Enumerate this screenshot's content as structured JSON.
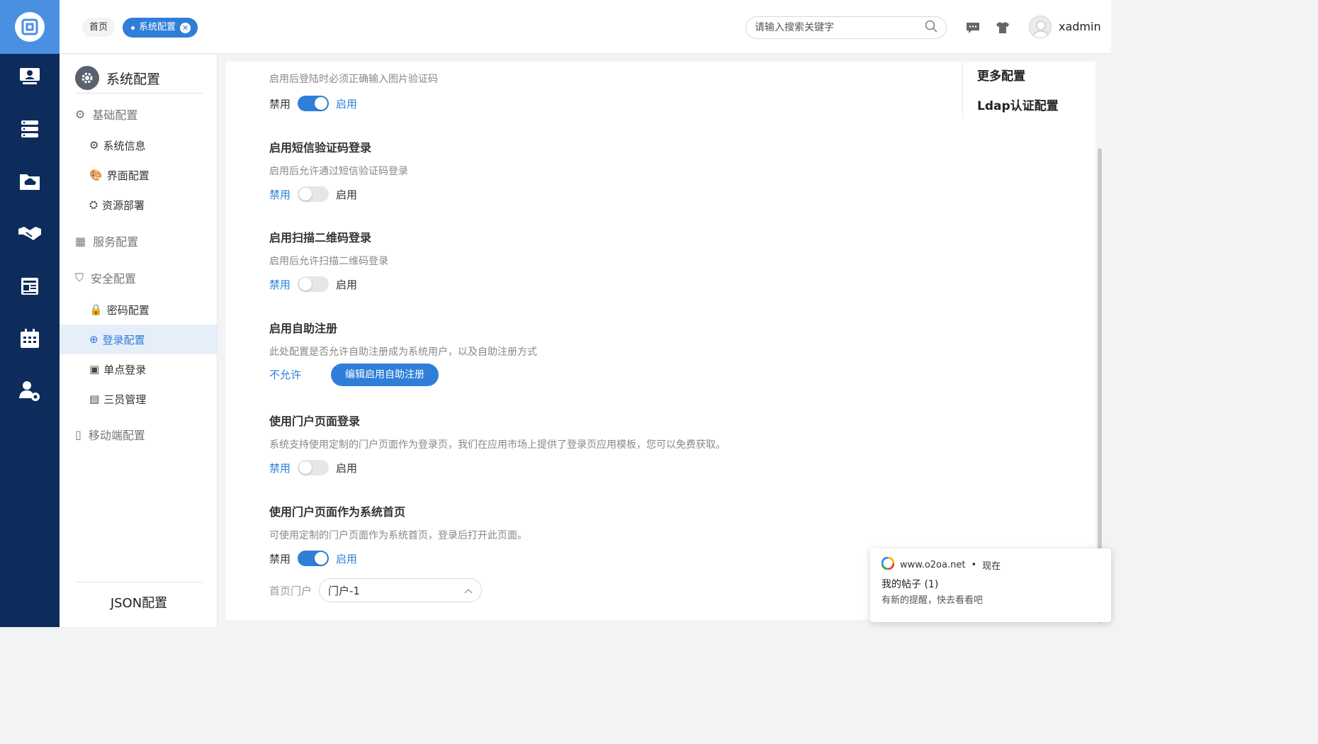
{
  "header": {
    "tabs": [
      {
        "label": "首页"
      },
      {
        "label": "系统配置"
      }
    ],
    "search_placeholder": "请输入搜索关键字",
    "username": "xadmin"
  },
  "rail_icons": [
    "logo-icon",
    "user-desk-icon",
    "server-icon",
    "cloud-folder-icon",
    "handshake-icon",
    "news-icon",
    "calendar-icon",
    "user-settings-icon"
  ],
  "subnav": {
    "title": "系统配置",
    "groups": {
      "basic": "基础配置",
      "service": "服务配置",
      "security": "安全配置",
      "mobile": "移动端配置"
    },
    "items": {
      "system_info": "系统信息",
      "ui_config": "界面配置",
      "resource_deploy": "资源部署",
      "password_config": "密码配置",
      "login_config": "登录配置",
      "sso": "单点登录",
      "three_admin": "三员管理"
    },
    "json_config": "JSON配置"
  },
  "main": {
    "captcha": {
      "desc": "启用后登陆时必须正确输入图片验证码",
      "off": "禁用",
      "on": "启用",
      "enabled": true
    },
    "sms": {
      "title": "启用短信验证码登录",
      "desc": "启用后允许通过短信验证码登录",
      "off": "禁用",
      "on": "启用",
      "enabled": false
    },
    "qrcode": {
      "title": "启用扫描二维码登录",
      "desc": "启用后允许扫描二维码登录",
      "off": "禁用",
      "on": "启用",
      "enabled": false
    },
    "self_register": {
      "title": "启用自助注册",
      "desc": "此处配置是否允许自助注册成为系统用户，以及自助注册方式",
      "status": "不允许",
      "button": "编辑启用自助注册"
    },
    "portal_login": {
      "title": "使用门户页面登录",
      "desc": "系统支持使用定制的门户页面作为登录页，我们在应用市场上提供了登录页应用模板，您可以免费获取。",
      "off": "禁用",
      "on": "启用",
      "enabled": false
    },
    "portal_home": {
      "title": "使用门户页面作为系统首页",
      "desc": "可使用定制的门户页面作为系统首页，登录后打开此页面。",
      "off": "禁用",
      "on": "启用",
      "enabled": true,
      "select_label": "首页门户",
      "select_value": "门户-1"
    },
    "anchors": [
      "更多配置",
      "Ldap认证配置"
    ]
  },
  "notification": {
    "site": "www.o2oa.net",
    "time": "现在",
    "title": "我的帖子 (1)",
    "body": "有新的提醒，快去看看吧"
  },
  "colors": {
    "rail": "#0d2c5c",
    "accent": "#2f7fd8",
    "logo_bg": "#4a90e2"
  }
}
